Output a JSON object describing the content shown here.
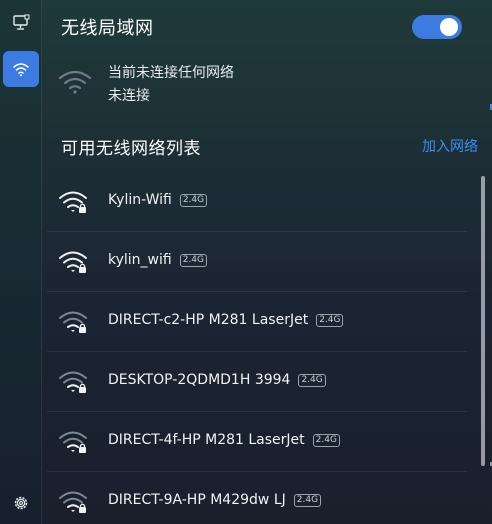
{
  "sidebar": {
    "items": [
      {
        "icon": "wired-network-icon",
        "active": false
      },
      {
        "icon": "wifi-icon",
        "active": true
      }
    ],
    "settings_icon": "gear-icon"
  },
  "wlan": {
    "title": "无线局域网",
    "toggle_on": true,
    "status_line1": "当前未连接任何网络",
    "status_line2": "未连接"
  },
  "list": {
    "title": "可用无线网络列表",
    "join_label": "加入网络",
    "networks": [
      {
        "ssid": "Kylin-Wifi",
        "band": "2.4G",
        "signal": 3,
        "secured": true
      },
      {
        "ssid": "kylin_wifi",
        "band": "2.4G",
        "signal": 3,
        "secured": true
      },
      {
        "ssid": "DIRECT-c2-HP M281 LaserJet",
        "band": "2.4G",
        "signal": 1,
        "secured": true
      },
      {
        "ssid": "DESKTOP-2QDMD1H 3994",
        "band": "2.4G",
        "signal": 1,
        "secured": true
      },
      {
        "ssid": "DIRECT-4f-HP M281 LaserJet",
        "band": "2.4G",
        "signal": 1,
        "secured": true
      },
      {
        "ssid": "DIRECT-9A-HP M429dw LJ",
        "band": "2.4G",
        "signal": 1,
        "secured": true
      }
    ]
  },
  "colors": {
    "accent": "#3d7be0",
    "link": "#3d8ef0"
  }
}
